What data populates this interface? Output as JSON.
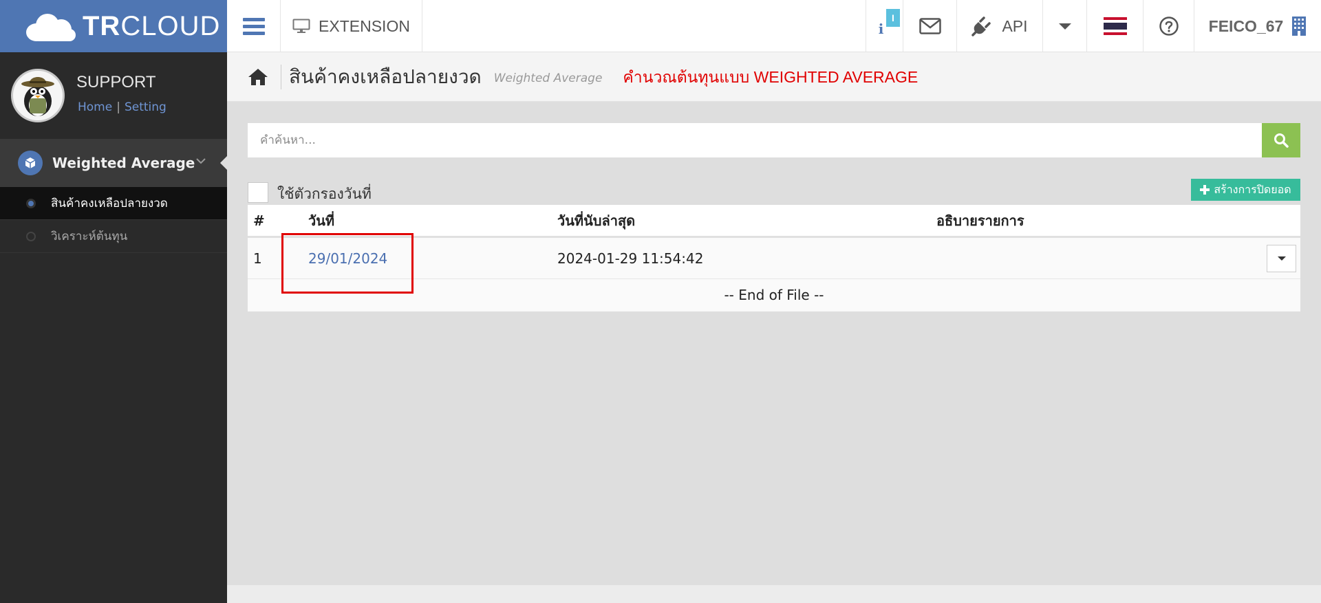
{
  "brand": {
    "bold": "TR",
    "light": "CLOUD"
  },
  "topbar": {
    "extension_label": "EXTENSION",
    "info_badge": "I",
    "info_letter": "i",
    "api_label": "API",
    "username": "FEICO_67"
  },
  "sidebar": {
    "profile_name": "SUPPORT",
    "home_link": "Home",
    "link_separator": "|",
    "setting_link": "Setting",
    "menu_title": "Weighted Average",
    "items": [
      {
        "label": "สินค้าคงเหลือปลายงวด"
      },
      {
        "label": "วิเคราะห์ต้นทุน"
      }
    ]
  },
  "page": {
    "title": "สินค้าคงเหลือปลายงวด",
    "subtitle": "Weighted Average",
    "note": "คำนวณต้นทุนแบบ WEIGHTED AVERAGE"
  },
  "search": {
    "placeholder": "คำค้นหา..."
  },
  "filter": {
    "label": "ใช้ตัวกรองวันที่"
  },
  "create_button": {
    "label": "สร้างการปิดยอด"
  },
  "table": {
    "headers": [
      "#",
      "วันที่",
      "วันที่นับล่าสุด",
      "อธิบายรายการ"
    ],
    "rows": [
      {
        "num": "1",
        "date": "29/01/2024",
        "last_count": "2024-01-29 11:54:42",
        "description": ""
      }
    ],
    "end_text": "-- End of File --"
  },
  "colors": {
    "brand_blue": "#4f76b3",
    "search_green": "#8cc152",
    "create_teal": "#37bc9b",
    "annotation_red": "#e00000"
  }
}
